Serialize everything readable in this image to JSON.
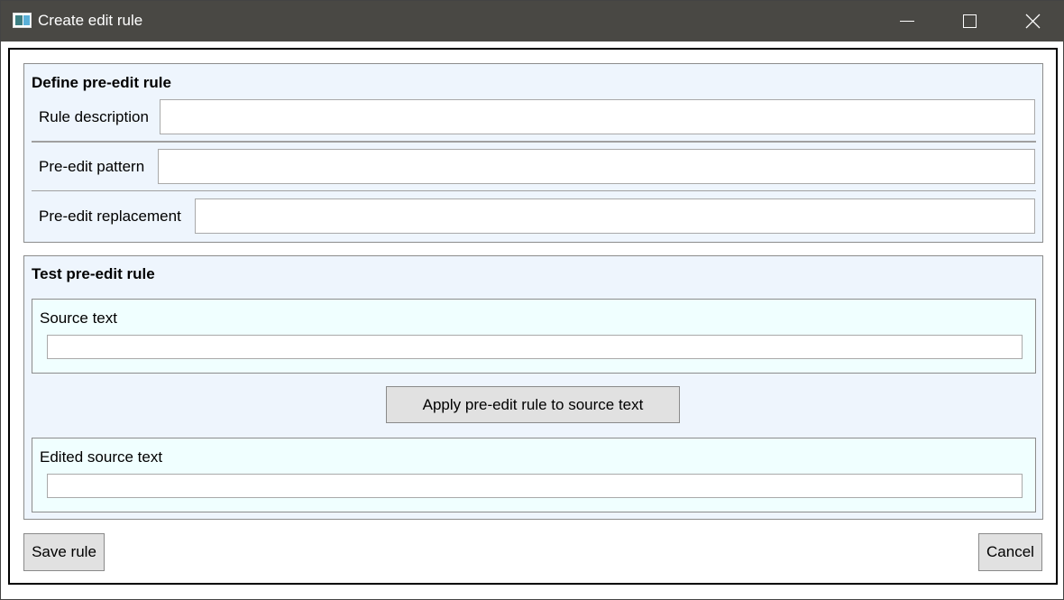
{
  "window": {
    "title": "Create edit rule"
  },
  "define_section": {
    "title": "Define pre-edit rule",
    "fields": [
      {
        "label": "Rule description",
        "value": ""
      },
      {
        "label": "Pre-edit pattern",
        "value": ""
      },
      {
        "label": "Pre-edit replacement",
        "value": ""
      }
    ]
  },
  "test_section": {
    "title": "Test pre-edit rule",
    "source_text": {
      "label": "Source text",
      "value": ""
    },
    "apply_button_label": "Apply pre-edit rule to source text",
    "edited_source_text": {
      "label": "Edited source text",
      "value": ""
    }
  },
  "footer": {
    "save_label": "Save rule",
    "cancel_label": "Cancel"
  },
  "icons": {
    "app": "app-window-icon",
    "minimize": "minimize-icon",
    "maximize": "maximize-icon",
    "close": "close-icon"
  }
}
